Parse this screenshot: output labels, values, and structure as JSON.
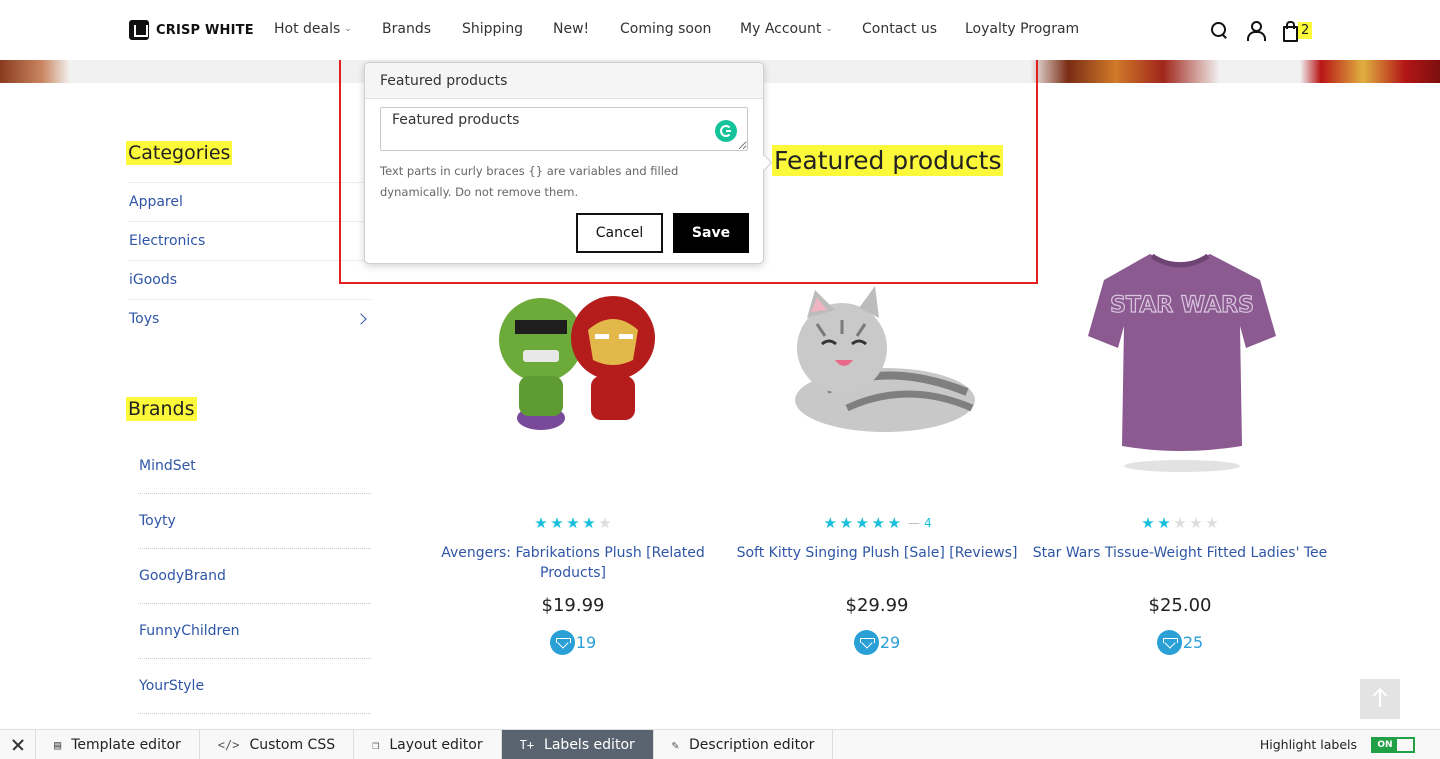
{
  "brand": {
    "name": "CRISP WHITE"
  },
  "nav": {
    "items": [
      {
        "label": "Hot deals",
        "dropdown": true
      },
      {
        "label": "Brands",
        "dropdown": false
      },
      {
        "label": "Shipping",
        "dropdown": false
      },
      {
        "label": "New!",
        "dropdown": false
      },
      {
        "label": "Coming soon",
        "dropdown": false
      },
      {
        "label": "My Account",
        "dropdown": true
      },
      {
        "label": "Contact us",
        "dropdown": false
      },
      {
        "label": "Loyalty Program",
        "dropdown": false
      }
    ],
    "cart_count": "2",
    "icons": [
      "search-icon",
      "user-icon",
      "shopping-bag-icon"
    ]
  },
  "sidebar": {
    "categories_title": "Categories",
    "categories": [
      "Apparel",
      "Electronics",
      "iGoods",
      "Toys"
    ],
    "brands_title": "Brands",
    "brands": [
      "MindSet",
      "Toyty",
      "GoodyBrand",
      "FunnyChildren",
      "YourStyle"
    ]
  },
  "section": {
    "heading": "Featured products"
  },
  "popover": {
    "title": "Featured products",
    "value": "Featured products",
    "hint": "Text parts in curly braces {} are variables and filled dynamically. Do not remove them.",
    "cancel_label": "Cancel",
    "save_label": "Save"
  },
  "products": [
    {
      "name": "Avengers: Fabrikations Plush [Related Products]",
      "price": "$19.99",
      "points": "19",
      "rating": 4,
      "reviews": ""
    },
    {
      "name": "Soft Kitty Singing Plush [Sale] [Reviews]",
      "price": "$29.99",
      "points": "29",
      "rating": 5,
      "reviews": "4"
    },
    {
      "name": "Star Wars Tissue-Weight Fitted Ladies' Tee",
      "price": "$25.00",
      "points": "25",
      "rating": 2,
      "reviews": ""
    }
  ],
  "product_image_text": {
    "tshirt_print": "STAR WARS"
  },
  "editor_bar": {
    "tabs": [
      {
        "label": "Template editor",
        "icon": "template-icon",
        "active": false
      },
      {
        "label": "Custom CSS",
        "icon": "code-icon",
        "active": false
      },
      {
        "label": "Layout editor",
        "icon": "layout-icon",
        "active": false
      },
      {
        "label": "Labels editor",
        "icon": "text-icon",
        "active": true
      },
      {
        "label": "Description editor",
        "icon": "edit-icon",
        "active": false
      }
    ],
    "highlight_label": "Highlight labels",
    "toggle_state": "ON"
  },
  "colors": {
    "highlight": "#fcf93a",
    "link": "#2f56a6",
    "accent": "#18c0dc",
    "frame": "#e32020",
    "toggle": "#21a045"
  }
}
